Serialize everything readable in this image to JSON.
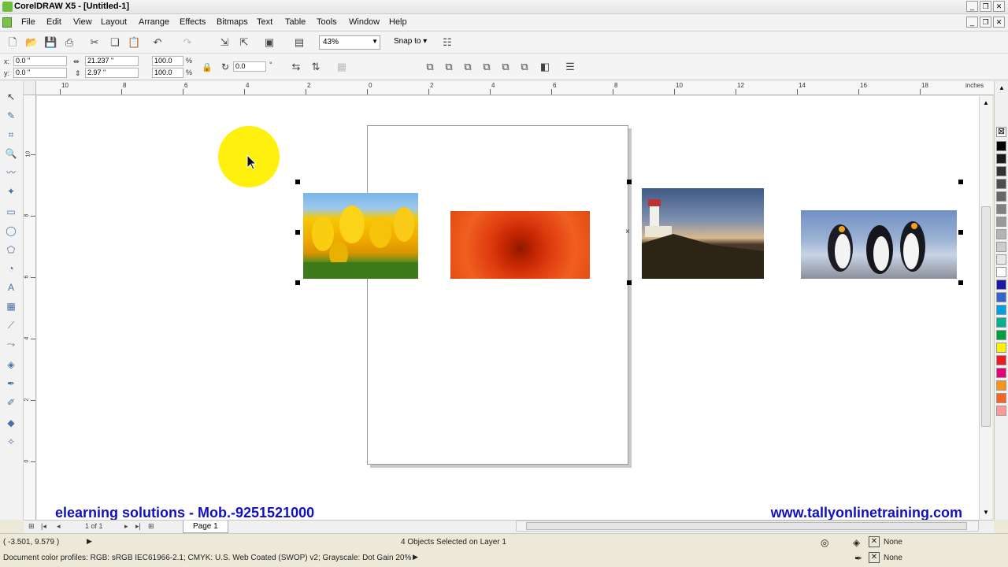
{
  "window": {
    "title": "CorelDRAW X5 - [Untitled-1]"
  },
  "menu": [
    "File",
    "Edit",
    "View",
    "Layout",
    "Arrange",
    "Effects",
    "Bitmaps",
    "Text",
    "Table",
    "Tools",
    "Window",
    "Help"
  ],
  "toolbar": {
    "zoom": "43%",
    "snap_to": "Snap to"
  },
  "property_bar": {
    "x_label": "x:",
    "x_value": "0.0 \"",
    "y_label": "y:",
    "y_value": "0.0 \"",
    "width_value": "21.237 \"",
    "height_value": "2.97 \"",
    "scale_x": "100.0",
    "scale_y": "100.0",
    "percent": "%",
    "rotation": "0.0",
    "degree": "°"
  },
  "ruler": {
    "top_labels": [
      "10",
      "8",
      "6",
      "4",
      "2",
      "0",
      "2",
      "4",
      "6",
      "8",
      "10",
      "12",
      "14",
      "16",
      "18"
    ],
    "unit": "inches",
    "left_labels": [
      "10",
      "8",
      "6",
      "4",
      "2",
      "0"
    ]
  },
  "canvas": {
    "photos": [
      "tulips",
      "red-flower",
      "lighthouse",
      "penguins"
    ]
  },
  "page_nav": {
    "page_count": "1 of 1",
    "page_tab": "Page 1"
  },
  "watermark": {
    "left": "elearning solutions - Mob.-9251521000",
    "right": "www.tallyonlinetraining.com"
  },
  "status": {
    "coords": "( -3.501, 9.579 )",
    "selection": "4 Objects Selected on Layer 1",
    "fill_label": "None",
    "outline_label": "None",
    "color_profiles": "Document color profiles: RGB: sRGB IEC61966-2.1; CMYK: U.S. Web Coated (SWOP) v2; Grayscale: Dot Gain 20%"
  },
  "palette_colors": [
    "#000000",
    "#1a1a1a",
    "#333333",
    "#4d4d4d",
    "#666666",
    "#808080",
    "#999999",
    "#b3b3b3",
    "#cccccc",
    "#e6e6e6",
    "#ffffff",
    "#1a1aa6",
    "#3366cc",
    "#00a0e0",
    "#00b090",
    "#00a040",
    "#fff200",
    "#ed1c24",
    "#e6007e",
    "#f7941d",
    "#f26522",
    "#ff9999"
  ]
}
